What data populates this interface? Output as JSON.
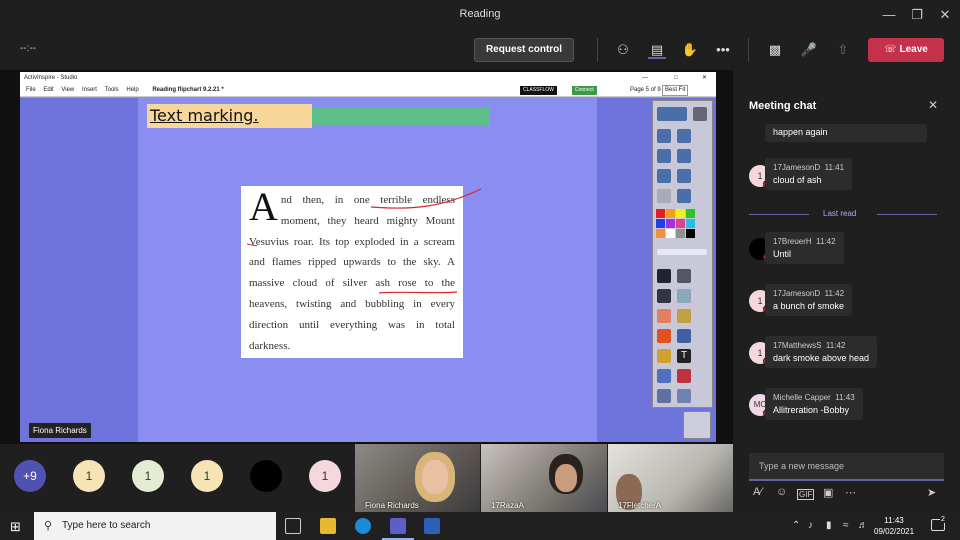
{
  "window": {
    "title": "Reading"
  },
  "toolbar": {
    "timer": "--:--",
    "request_control": "Request control",
    "leave": "Leave"
  },
  "shared_app": {
    "app_title": "ActivInspire - Studio",
    "menus": [
      "File",
      "Edit",
      "View",
      "Insert",
      "Tools",
      "Help"
    ],
    "tab": "Reading flipchart 9.2.21 *",
    "brand": "CLASSFLOW",
    "connect": "Connect",
    "page_indicator": "Page 5 of 9",
    "fit": "Best Fit",
    "heading": "Text marking.",
    "dropcap": "A",
    "passage": "nd then, in one terrible endless moment, they heard mighty Mount Vesuvius roar. Its top exploded in a scream and flames ripped upwards to the sky. A massive cloud of silver ash rose to the heavens, twisting and bubbling in every direction until everything was in total darkness.",
    "presenter": "Fiona Richards"
  },
  "participants": {
    "overflow": "+9",
    "avatars": [
      {
        "label": "1",
        "color": "#f6e4b4"
      },
      {
        "label": "1",
        "color": "#e4ecd4"
      },
      {
        "label": "1",
        "color": "#f6e4b4"
      },
      {
        "label": "",
        "color": "#000000"
      },
      {
        "label": "1",
        "color": "#f5d8de"
      }
    ],
    "videos": [
      "Fiona Richards",
      "17RazaA",
      "17FletcherA"
    ]
  },
  "chat": {
    "title": "Meeting chat",
    "last_read": "Last read",
    "compose_placeholder": "Type a new message",
    "messages": [
      {
        "author": "",
        "time": "",
        "text": "happen again",
        "avatar": ""
      },
      {
        "author": "17JamesonD",
        "time": "11:41",
        "text": "cloud of ash",
        "avatar": "1"
      },
      {
        "author": "17BreuerH",
        "time": "11:42",
        "text": "Until",
        "avatar": ""
      },
      {
        "author": "17JamesonD",
        "time": "11:42",
        "text": "a bunch of smoke",
        "avatar": "1"
      },
      {
        "author": "17MatthewsS",
        "time": "11:42",
        "text": "dark smoke above head",
        "avatar": "1"
      },
      {
        "author": "Michelle Capper",
        "time": "11:43",
        "text": "Allitreration -Bobby",
        "avatar": "MC"
      }
    ]
  },
  "taskbar": {
    "search_placeholder": "Type here to search",
    "time": "11:43",
    "date": "09/02/2021",
    "notifications": "2"
  },
  "colors": {
    "leave": "#c4314b",
    "accent": "#6264a7",
    "slide": "#8a8ef0"
  }
}
